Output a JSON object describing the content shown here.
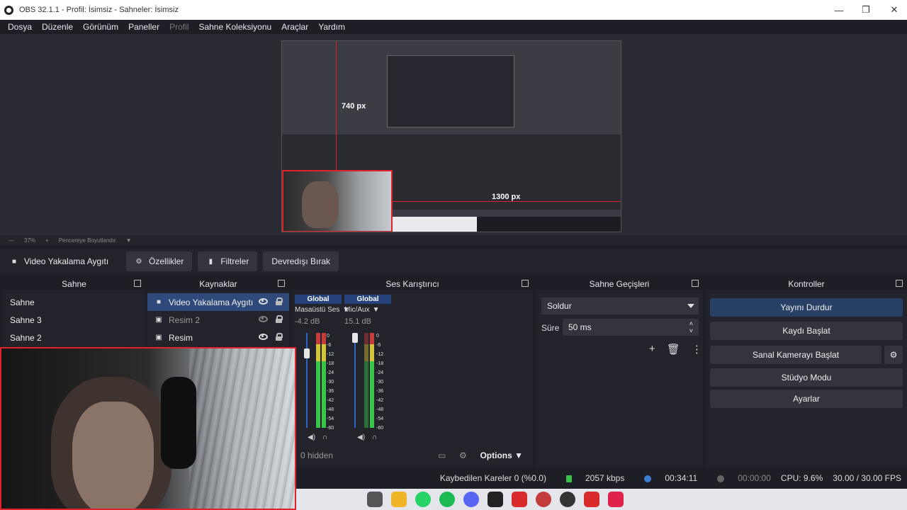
{
  "window": {
    "title": "OBS 32.1.1 - Profil: İsimsiz - Sahneler: İsimsiz",
    "minimize": "—",
    "maximize": "❐",
    "close": "✕"
  },
  "menu": [
    "Dosya",
    "Düzenle",
    "Görünüm",
    "Paneller",
    "Profil",
    "Sahne Koleksiyonu",
    "Araçlar",
    "Yardım"
  ],
  "preview": {
    "label_width": "740 px",
    "label_height": "1300 px",
    "zoom": "37%",
    "fit_label": "Pencereye Boyutlandır"
  },
  "source_toolbar": {
    "source_name": "Video Yakalama Aygıtı",
    "properties": "Özellikler",
    "filters": "Filtreler",
    "deactivate": "Devredışı Bırak"
  },
  "scenes": {
    "title": "Sahne",
    "items": [
      "Sahne",
      "Sahne 3",
      "Sahne 2"
    ]
  },
  "sources": {
    "title": "Kaynaklar",
    "items": [
      {
        "label": "Video Yakalama Aygıtı",
        "selected": true,
        "visible": true
      },
      {
        "label": "Resim 2",
        "selected": false,
        "visible": false
      },
      {
        "label": "Resim",
        "selected": false,
        "visible": true
      }
    ]
  },
  "mixer": {
    "title": "Ses Karıştırıcı",
    "channels": [
      {
        "header": "Global",
        "name": "Masaüstü Ses",
        "db": "-4.2 dB"
      },
      {
        "header": "Global",
        "name": "Mic/Aux",
        "db": "15.1 dB"
      }
    ],
    "scale": [
      "0",
      "-6",
      "-12",
      "-18",
      "-24",
      "-30",
      "-36",
      "-42",
      "-48",
      "-54",
      "-60"
    ],
    "hidden": "0 hidden",
    "options": "Options"
  },
  "transitions": {
    "title": "Sahne Geçişleri",
    "selected": "Soldur",
    "duration_label": "Süre",
    "duration_value": "50 ms"
  },
  "controls": {
    "title": "Kontroller",
    "buttons": [
      "Yayını Durdur",
      "Kaydı Başlat",
      "Sanal Kamerayı Başlat",
      "Stüdyo Modu",
      "Ayarlar"
    ]
  },
  "status": {
    "dropped": "Kaybedilen Kareler 0 (%0.0)",
    "bitrate": "2057 kbps",
    "stream_time": "00:34:11",
    "record_time": "00:00:00",
    "cpu": "CPU: 9.6%",
    "fps": "30.00 / 30.00 FPS"
  },
  "colors": {
    "accent": "#2f4a7a",
    "red_highlight": "#e0222a",
    "panel": "#23242b"
  }
}
